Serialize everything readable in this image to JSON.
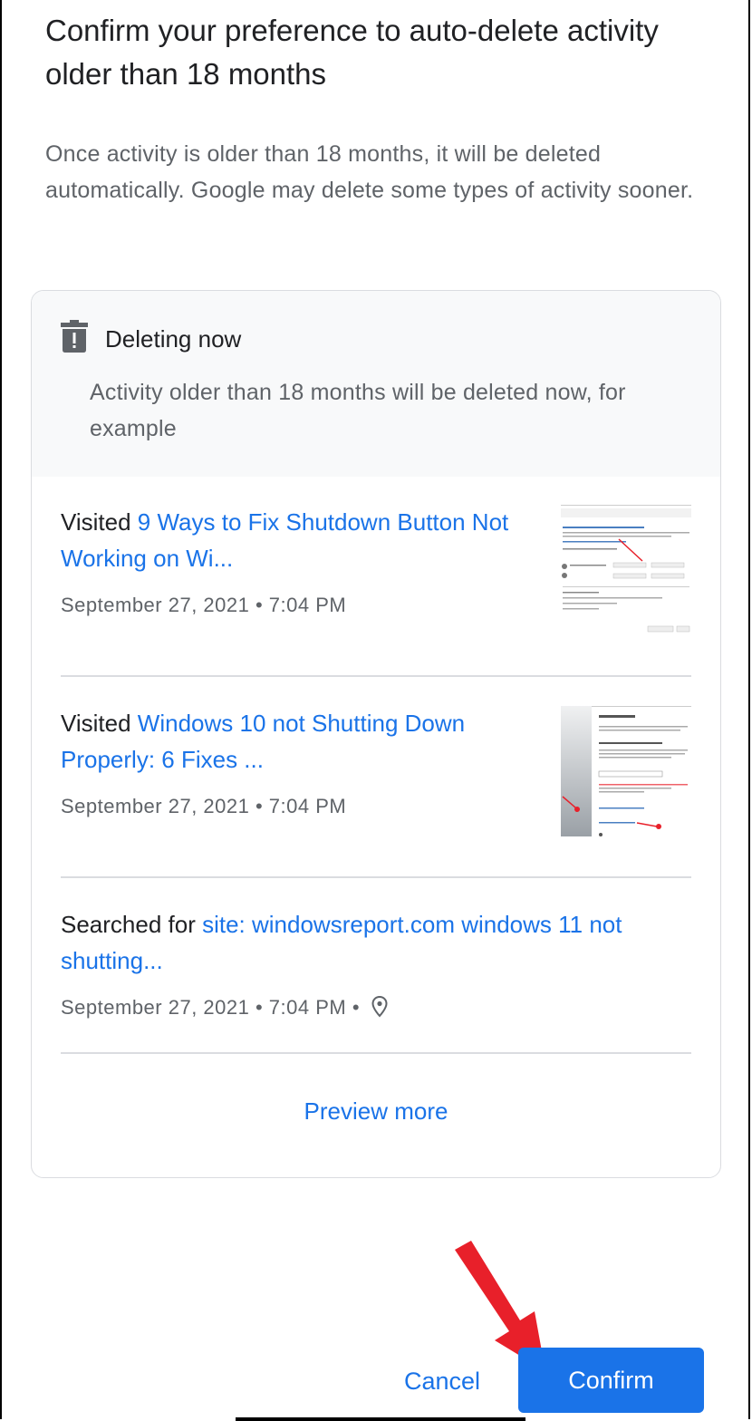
{
  "dialog": {
    "title": "Confirm your preference to auto-delete activity older than 18 months",
    "description": "Once activity is older than 18 months, it will be deleted automatically. Google may delete some types of activity sooner."
  },
  "card": {
    "heading": "Deleting now",
    "subheading": "Activity older than 18 months will be deleted now, for example",
    "items": [
      {
        "prefix": "Visited ",
        "link": "9 Ways to Fix Shutdown Button Not Working on Wi...",
        "date": "September 27, 2021 • 7:04 PM",
        "thumbnail": "system-settings-screenshot"
      },
      {
        "prefix": "Visited ",
        "link": "Windows 10 not Shutting Down Properly: 6 Fixes ...",
        "date": "September 27, 2021 • 7:04 PM",
        "thumbnail": "troubleshoot-screenshot"
      },
      {
        "prefix": "Searched for ",
        "link": "site: windowsreport.com windows 11 not shutting...",
        "date": "September 27, 2021 • 7:04 PM •",
        "icon": "location-pin-icon"
      }
    ],
    "preview_more": "Preview more"
  },
  "actions": {
    "cancel": "Cancel",
    "confirm": "Confirm"
  },
  "colors": {
    "accent": "#1a73e8",
    "annotation_arrow": "#e8202a"
  }
}
